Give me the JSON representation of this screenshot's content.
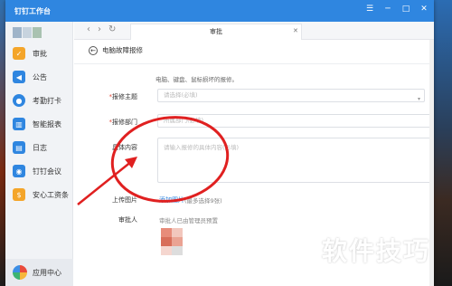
{
  "app": {
    "title": "钉钉工作台"
  },
  "window_controls": [
    "☰",
    "─",
    "□",
    "✕"
  ],
  "sidebar": {
    "items": [
      {
        "label": "审批",
        "icon": "approval-icon",
        "color": "#f4a52a"
      },
      {
        "label": "公告",
        "icon": "announcement-icon",
        "color": "#2f86e0"
      },
      {
        "label": "考勤打卡",
        "icon": "location-pin-icon",
        "color": "#2f86e0"
      },
      {
        "label": "智能报表",
        "icon": "chart-icon",
        "color": "#2f86e0"
      },
      {
        "label": "日志",
        "icon": "log-icon",
        "color": "#2f86e0"
      },
      {
        "label": "钉钉会议",
        "icon": "meeting-icon",
        "color": "#2f86e0"
      },
      {
        "label": "安心工资条",
        "icon": "payslip-icon",
        "color": "#f4a52a"
      }
    ],
    "footer": {
      "label": "应用中心",
      "icon": "app-center-icon"
    }
  },
  "tab": {
    "label": "审批",
    "close": "✕"
  },
  "nav": {
    "back": "‹",
    "forward": "›",
    "refresh": "↻"
  },
  "page": {
    "back_icon": "←",
    "title": "电脑故障报修"
  },
  "form": {
    "hint": "电脑、键盘、鼠标损坏的报修。",
    "fields": [
      {
        "label": "报修主题",
        "required": true,
        "placeholder": "请选择(必填)"
      },
      {
        "label": "报修部门",
        "required": true,
        "placeholder": "所属部门(必填)"
      },
      {
        "label": "具体内容",
        "required": false,
        "placeholder": "请输入报修的具体内容(必填)"
      }
    ],
    "upload": {
      "label": "上传图片",
      "link": "添加图片",
      "note": "(最多选择9张)"
    },
    "approver": {
      "label": "审批人",
      "note": "审批人已由管理员预置"
    }
  },
  "watermark": "软件技巧",
  "annotation_color": "#e02020"
}
